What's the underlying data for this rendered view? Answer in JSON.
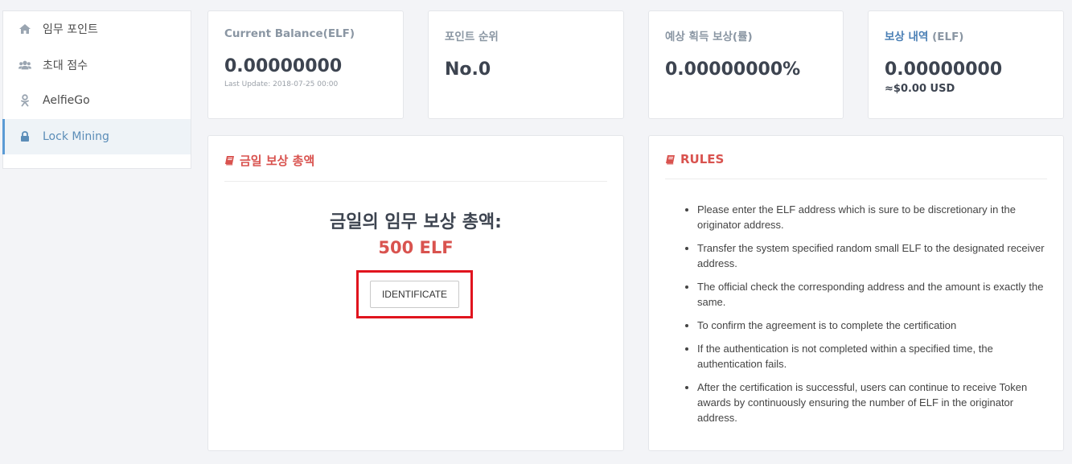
{
  "sidebar": {
    "items": [
      {
        "label": "임무 포인트",
        "icon": "home-icon"
      },
      {
        "label": "초대 점수",
        "icon": "users-icon"
      },
      {
        "label": "AelfieGo",
        "icon": "odnoklassniki-icon"
      },
      {
        "label": "Lock Mining",
        "icon": "lock-icon",
        "active": true
      }
    ]
  },
  "stats": {
    "balance": {
      "title": "Current Balance(ELF)",
      "value": "0.00000000",
      "updated": "Last Update: 2018-07-25 00:00"
    },
    "rank": {
      "title": "포인트 순위",
      "value": "No.0"
    },
    "expected": {
      "title": "예상 획득 보상(률)",
      "value": "0.00000000%"
    },
    "history": {
      "title": "보상 내역",
      "title_suffix": "(ELF)",
      "value": "0.00000000",
      "usd": "≈$0.00 USD"
    }
  },
  "reward_panel": {
    "heading": "금일 보상 총액",
    "title": "금일의 임무 보상 총액:",
    "amount": "500 ELF",
    "button": "IDENTIFICATE"
  },
  "rules_panel": {
    "heading": "RULES",
    "items": [
      "Please enter the ELF address which is sure to be discretionary in the originator address.",
      "Transfer the system specified random small ELF to the designated receiver address.",
      "The official check the corresponding address and the amount is exactly the same.",
      "To confirm the agreement is to complete the certification",
      "If the authentication is not completed within a specified time, the authentication fails.",
      "After the certification is successful, users can continue to receive Token awards by continuously ensuring the number of ELF in the originator address."
    ]
  },
  "colors": {
    "accent_red": "#d9534f",
    "accent_blue": "#4a7fb5",
    "highlight_box": "#e0141e"
  }
}
